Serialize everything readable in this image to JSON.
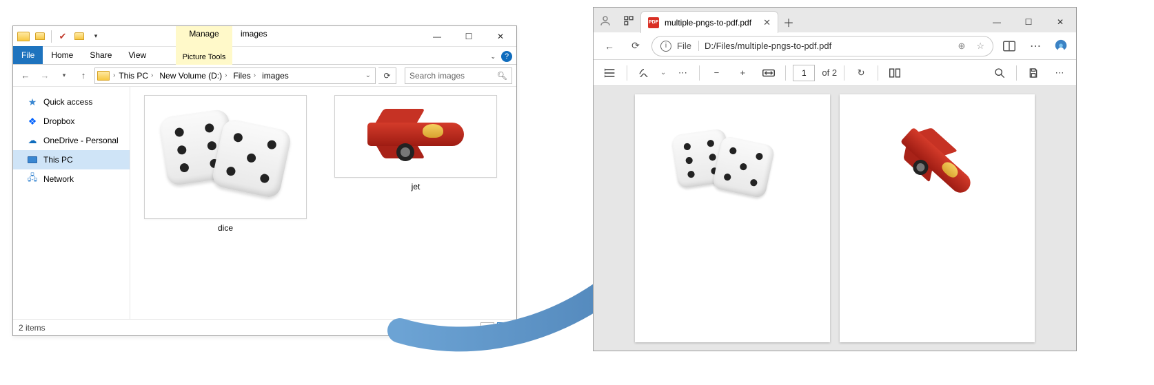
{
  "explorer": {
    "title": "images",
    "ribbon": {
      "file": "File",
      "home": "Home",
      "share": "Share",
      "view": "View",
      "manage": "Manage",
      "picture_tools": "Picture Tools"
    },
    "breadcrumb": [
      "This PC",
      "New Volume (D:)",
      "Files",
      "images"
    ],
    "search_placeholder": "Search images",
    "nav": {
      "quick": "Quick access",
      "dropbox": "Dropbox",
      "onedrive": "OneDrive - Personal",
      "thispc": "This PC",
      "network": "Network"
    },
    "items": [
      {
        "name": "dice"
      },
      {
        "name": "jet"
      }
    ],
    "status": "2 items"
  },
  "edge": {
    "tab_title": "multiple-pngs-to-pdf.pdf",
    "url_prefix": "File",
    "url_path": "D:/Files/multiple-pngs-to-pdf.pdf",
    "pdf": {
      "page_current": "1",
      "page_total": "of 2"
    }
  }
}
